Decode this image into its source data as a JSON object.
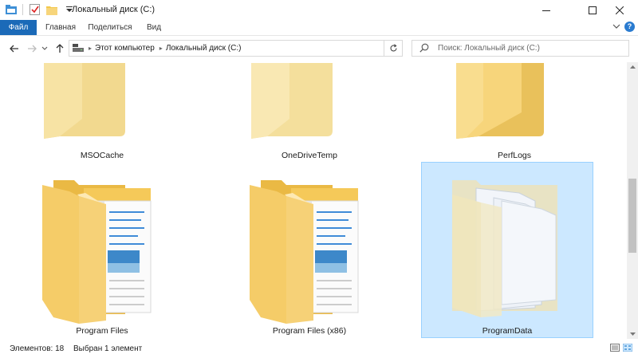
{
  "window": {
    "title": "Локальный диск (C:)",
    "minimize_icon": "minimize-icon",
    "maximize_icon": "maximize-icon",
    "close_icon": "close-icon"
  },
  "quick_access": [
    "explorer-icon",
    "properties-checkmark-icon",
    "new-folder-icon",
    "customize-dropdown-icon"
  ],
  "ribbon": {
    "tabs": [
      {
        "label": "Файл",
        "active": true
      },
      {
        "label": "Главная"
      },
      {
        "label": "Поделиться"
      },
      {
        "label": "Вид"
      }
    ],
    "help_label": "?"
  },
  "nav": {
    "breadcrumb": [
      "Этот компьютер",
      "Локальный диск (C:)"
    ],
    "search_placeholder": "Поиск: Локальный диск (C:)"
  },
  "items": [
    {
      "name": "MSOCache",
      "type": "folder-empty"
    },
    {
      "name": "OneDriveTemp",
      "type": "folder-empty"
    },
    {
      "name": "PerfLogs",
      "type": "folder-empty"
    },
    {
      "name": "Program Files",
      "type": "folder-docs",
      "selected": false
    },
    {
      "name": "Program Files (x86)",
      "type": "folder-docs",
      "selected": false
    },
    {
      "name": "ProgramData",
      "type": "folder-hidden",
      "selected": true
    }
  ],
  "status": {
    "items_count": "Элементов: 18",
    "selected": "Выбран 1 элемент"
  },
  "colors": {
    "accent": "#1b6ab8",
    "folder_yellow": "#f7d57b",
    "selection_bg": "#cce8ff",
    "selection_border": "#99d1ff"
  }
}
